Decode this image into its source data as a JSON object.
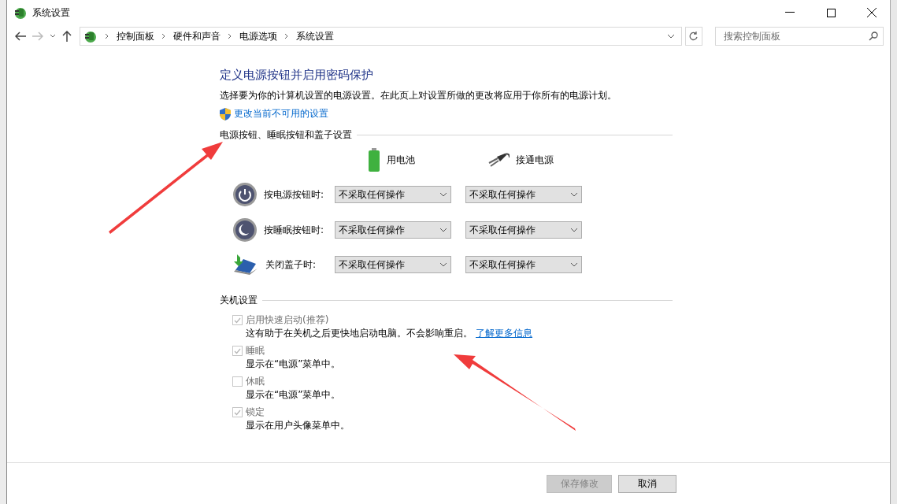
{
  "window": {
    "title": "系统设置"
  },
  "address_bar": {
    "breadcrumbs": [
      "控制面板",
      "硬件和声音",
      "电源选项",
      "系统设置"
    ]
  },
  "search": {
    "placeholder": "搜索控制面板"
  },
  "heading": "定义电源按钮并启用密码保护",
  "description": "选择要为你的计算机设置的电源设置。在此页上对设置所做的更改将应用于你所有的电源计划。",
  "admin_link": "更改当前不可用的设置",
  "buttons_section": {
    "title": "电源按钮、睡眠按钮和盖子设置",
    "columns": [
      {
        "label": "用电池",
        "kind": "battery"
      },
      {
        "label": "接通电源",
        "kind": "plug"
      }
    ],
    "rows": [
      {
        "kind": "power",
        "label": "按电源按钮时:",
        "values": [
          "不采取任何操作",
          "不采取任何操作"
        ]
      },
      {
        "kind": "sleep",
        "label": "按睡眠按钮时:",
        "values": [
          "不采取任何操作",
          "不采取任何操作"
        ]
      },
      {
        "kind": "lid",
        "label": "关闭盖子时:",
        "values": [
          "不采取任何操作",
          "不采取任何操作"
        ]
      }
    ]
  },
  "shutdown_section": {
    "title": "关机设置",
    "options": [
      {
        "label": "启用快速启动(推荐)",
        "checked": true,
        "disabled": true,
        "description": "这有助于在关机之后更快地启动电脑。不会影响重启。",
        "link": "了解更多信息"
      },
      {
        "label": "睡眠",
        "checked": true,
        "disabled": true,
        "description": "显示在“电源”菜单中。"
      },
      {
        "label": "休眠",
        "checked": false,
        "disabled": true,
        "description": "显示在“电源”菜单中。"
      },
      {
        "label": "锁定",
        "checked": true,
        "disabled": true,
        "description": "显示在用户头像菜单中。"
      }
    ]
  },
  "footer_buttons": [
    {
      "label": "保存修改",
      "disabled": true
    },
    {
      "label": "取消",
      "disabled": false
    }
  ]
}
